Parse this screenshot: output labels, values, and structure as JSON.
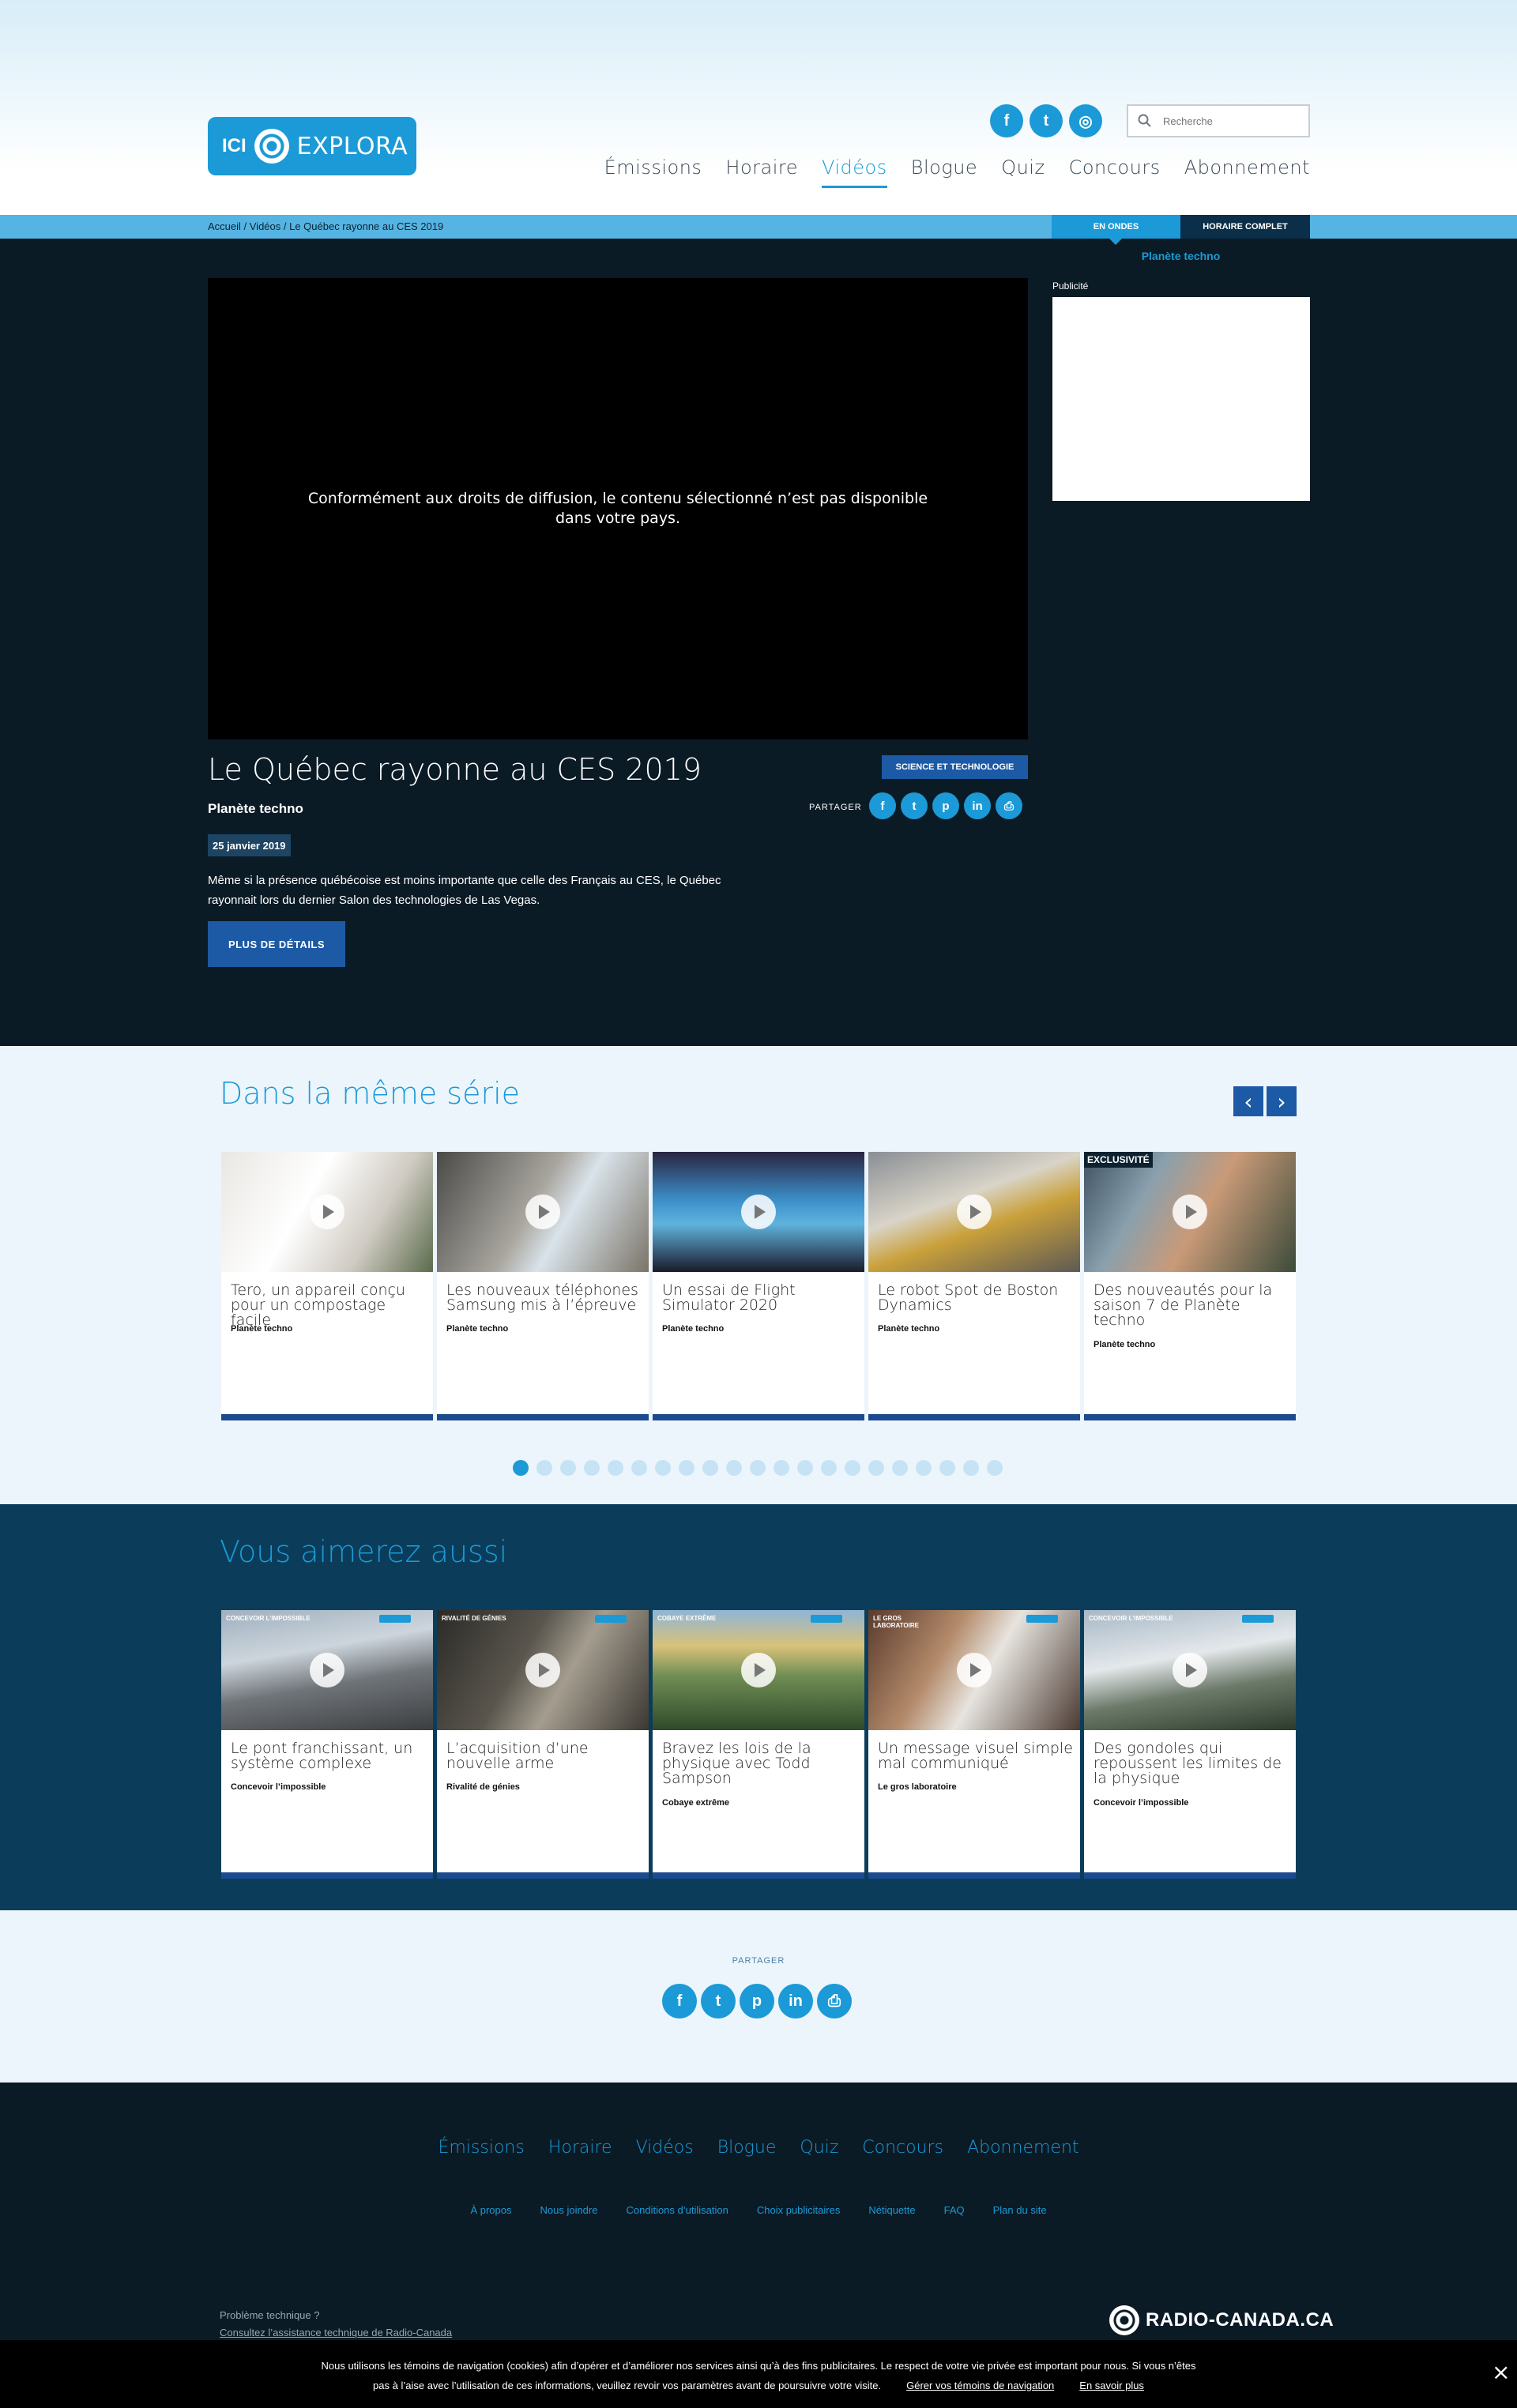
{
  "header": {
    "logo_prefix": "ICI",
    "logo_word": "EXPLORA",
    "search_placeholder": "Recherche",
    "nav": [
      "Émissions",
      "Horaire",
      "Vidéos",
      "Blogue",
      "Quiz",
      "Concours",
      "Abonnement"
    ],
    "active_nav": "Vidéos",
    "social": [
      "facebook-icon",
      "twitter-icon",
      "instagram-icon"
    ]
  },
  "breadcrumb": "Accueil / Vidéos / Le Québec rayonne au CES 2019",
  "onair": {
    "tab_ondes": "EN ONDES",
    "tab_horaire": "HORAIRE COMPLET",
    "current": "Planète techno"
  },
  "video": {
    "unavailable_msg": "Conformément aux droits de diffusion, le contenu sélectionné n’est pas disponible dans votre pays.",
    "title": "Le Québec rayonne au CES 2019",
    "show": "Planète techno",
    "date": "25 janvier 2019",
    "description": "Même si la présence québécoise est moins importante que celle des Français au CES, le Québec rayonnait lors du dernier Salon des technologies de Las Vegas.",
    "details_button": "PLUS DE DÉTAILS",
    "category": "SCIENCE ET TECHNOLOGIE",
    "share_label": "PARTAGER"
  },
  "ad_label": "Publicité",
  "series": {
    "title": "Dans la même série",
    "cards": [
      {
        "title": "Tero, un appareil conçu pour un compostage facile",
        "show": "Planète techno",
        "badge": ""
      },
      {
        "title": "Les nouveaux téléphones Samsung mis à l’épreuve",
        "show": "Planète techno",
        "badge": ""
      },
      {
        "title": "Un essai de Flight Simulator 2020",
        "show": "Planète techno",
        "badge": ""
      },
      {
        "title": "Le robot Spot de Boston Dynamics",
        "show": "Planète techno",
        "badge": ""
      },
      {
        "title": "Des nouveautés pour la saison 7 de Planète techno",
        "show": "Planète techno",
        "badge": "EXCLUSIVITÉ"
      }
    ],
    "pages": 21,
    "current_page": 1
  },
  "also": {
    "title": "Vous aimerez aussi",
    "cards": [
      {
        "title": "Le pont franchissant, un système complexe",
        "show": "Concevoir l’impossible",
        "overlay": "Concevoir l’impossible"
      },
      {
        "title": "L’acquisition d’une nouvelle arme",
        "show": "Rivalité de génies",
        "overlay": "Rivalité de génies"
      },
      {
        "title": "Bravez les lois de la physique avec Todd Sampson",
        "show": "Cobaye extrême",
        "overlay": "Cobaye extrême"
      },
      {
        "title": "Un message visuel simple mal communiqué",
        "show": "Le gros laboratoire",
        "overlay": "Le gros laboratoire"
      },
      {
        "title": "Des gondoles qui repoussent les limites de la physique",
        "show": "Concevoir l’impossible",
        "overlay": "Concevoir l’impossible"
      }
    ]
  },
  "share_section": {
    "label": "PARTAGER"
  },
  "footer": {
    "nav": [
      "Émissions",
      "Horaire",
      "Vidéos",
      "Blogue",
      "Quiz",
      "Concours",
      "Abonnement"
    ],
    "links": [
      "À propos",
      "Nous joindre",
      "Conditions d’utilisation",
      "Choix publicitaires",
      "Nétiquette",
      "FAQ",
      "Plan du site"
    ],
    "tech_problem": "Problème technique ?",
    "tech_link": "Consultez l’assistance technique de Radio-Canada",
    "brand": "RADIO-CANADA.CA"
  },
  "cookie": {
    "line1": "Nous utilisons les témoins de navigation (cookies) afin d’opérer et d’améliorer nos services ainsi qu’à des fins publicitaires. Le respect de votre vie privée est important pour nous. Si vous n’êtes",
    "line2": "pas à l’aise avec l’utilisation de ces informations, veuillez revoir vos paramètres avant de poursuivre votre visite.",
    "manage": "Gérer vos témoins de navigation",
    "more": "En savoir plus",
    "close": "×"
  },
  "colors": {
    "accent": "#1b9ad7",
    "dark": "#0b1b26",
    "navy": "#0b3d5b",
    "button": "#1c5aa6"
  }
}
